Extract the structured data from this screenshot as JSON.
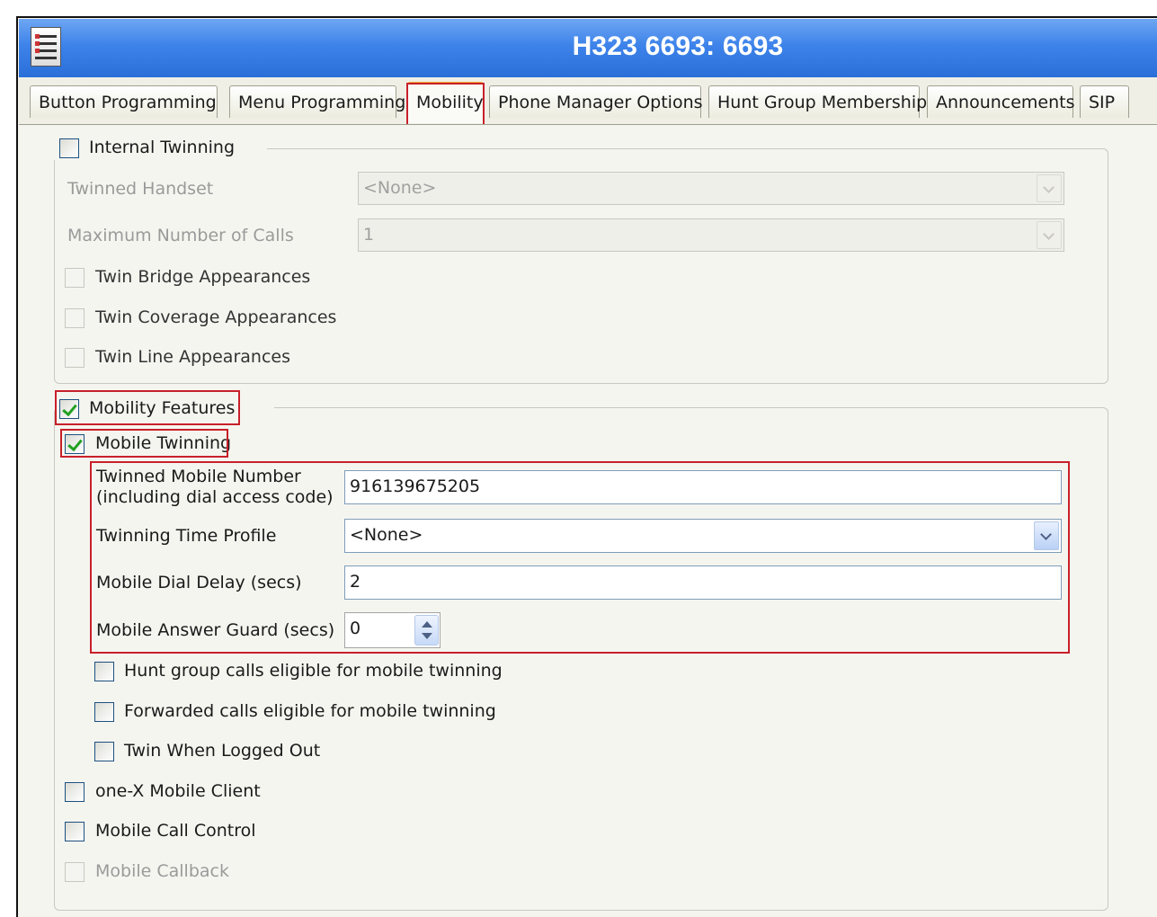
{
  "window": {
    "title": "H323 6693: 6693"
  },
  "tabs": [
    {
      "label": "Button Programming"
    },
    {
      "label": "Menu Programming"
    },
    {
      "label": "Mobility"
    },
    {
      "label": "Phone Manager Options"
    },
    {
      "label": "Hunt Group Membership"
    },
    {
      "label": "Announcements"
    },
    {
      "label": "SIP"
    }
  ],
  "active_tab": "Mobility",
  "internal_twinning": {
    "label": "Internal Twinning",
    "checked": false,
    "twinned_handset": {
      "label": "Twinned Handset",
      "value": "<None>"
    },
    "max_calls": {
      "label": "Maximum Number of Calls",
      "value": "1"
    },
    "bridge": {
      "label": "Twin Bridge Appearances",
      "checked": false
    },
    "coverage": {
      "label": "Twin Coverage Appearances",
      "checked": false
    },
    "line": {
      "label": "Twin Line Appearances",
      "checked": false
    }
  },
  "mobility_features": {
    "label": "Mobility Features",
    "checked": true,
    "mobile_twinning": {
      "label": "Mobile Twinning",
      "checked": true
    },
    "twinned_number": {
      "label_line1": "Twinned Mobile Number",
      "label_line2": "(including dial access code)",
      "value": "916139675205"
    },
    "time_profile": {
      "label": "Twinning Time Profile",
      "value": "<None>"
    },
    "dial_delay": {
      "label": "Mobile Dial Delay (secs)",
      "value": "2"
    },
    "answer_guard": {
      "label": "Mobile Answer Guard (secs)",
      "value": "0"
    },
    "hunt_group": {
      "label": "Hunt group calls eligible for mobile twinning",
      "checked": false
    },
    "forwarded": {
      "label": "Forwarded calls eligible for mobile twinning",
      "checked": false
    },
    "logged_out": {
      "label": "Twin When Logged Out",
      "checked": false
    },
    "onex": {
      "label": "one-X Mobile Client",
      "checked": false
    },
    "call_control": {
      "label": "Mobile Call Control",
      "checked": false
    },
    "callback": {
      "label": "Mobile Callback",
      "checked": false
    }
  },
  "colors": {
    "title_bar": "#3d83ea",
    "highlight_box": "#c8202a",
    "check_mark": "#21a121"
  }
}
